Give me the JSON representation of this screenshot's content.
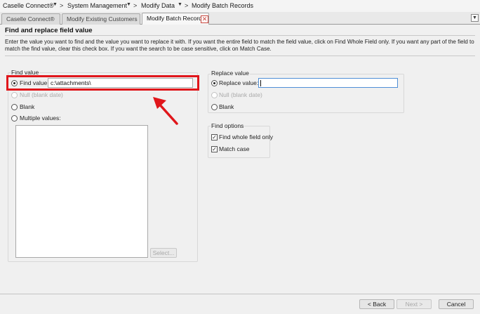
{
  "breadcrumb": {
    "items": [
      "Caselle Connect®",
      "System Management",
      "Modify Data",
      "Modify Batch Records"
    ],
    "separator": ">",
    "caret": "▼"
  },
  "tabs": [
    {
      "label": "Caselle Connect®",
      "active": false
    },
    {
      "label": "Modify Existing Customers",
      "active": false
    },
    {
      "label": "Modify Batch Records",
      "active": true
    }
  ],
  "tab_close_glyph": "✕",
  "tab_menu_glyph": "▼",
  "page": {
    "title": "Find and replace field value",
    "description": "Enter the value you want to find and the value you want to replace it with.  If you want the entire field to match the field value, click on Find Whole Field only.  If you want any part of the field to match the find value, clear this check box.  If you want the search to be case sensitive, click on Match Case."
  },
  "find_group": {
    "title": "Find value",
    "find_value_label": "Find value:",
    "find_value": "c:\\attachments\\",
    "null_label": "Null (blank date)",
    "blank_label": "Blank",
    "multiple_label": "Multiple values:",
    "select_button": "Select..."
  },
  "replace_group": {
    "title": "Replace value",
    "replace_value_label": "Replace value:",
    "replace_value": "",
    "null_label": "Null (blank date)",
    "blank_label": "Blank"
  },
  "options_group": {
    "title": "Find options",
    "whole_field_label": "Find whole field only",
    "whole_field_checked": true,
    "match_case_label": "Match case",
    "match_case_checked": true,
    "check_glyph": "✓"
  },
  "footer": {
    "back": "< Back",
    "next": "Next >",
    "cancel": "Cancel"
  },
  "colors": {
    "highlight": "#e0161b",
    "arrow": "#e0161b"
  }
}
